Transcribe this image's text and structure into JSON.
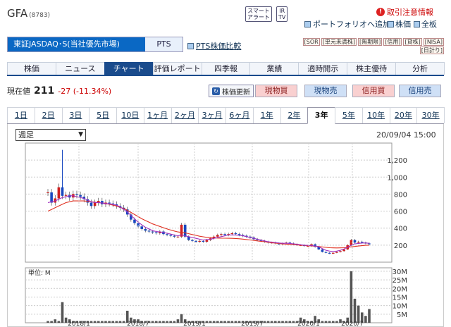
{
  "header": {
    "company": "GFA",
    "code": "(8783)",
    "btn_smart_line1": "スマート",
    "btn_smart_line2": "アラート",
    "btn_ir_line1": "IR",
    "btn_ir_line2": "TV",
    "alert_label": "取引注意情報",
    "portfolio_label": "ポートフォリオへ追加",
    "link_stock": "株価",
    "link_board": "全板"
  },
  "market": {
    "selected": "東証JASDAQ･S(当社優先市場)",
    "pts": "PTS",
    "pts_compare": "PTS株価比較"
  },
  "tags": {
    "line1": [
      "[SOR",
      "[単元未満株]",
      "[無期限]",
      "[信用]",
      "[貸株]",
      "[NISA]"
    ],
    "line2": "[日計り]"
  },
  "nav": [
    "株価",
    "ニュース",
    "チャート",
    "評価レポート",
    "四季報",
    "業績",
    "適時開示",
    "株主優待",
    "分析"
  ],
  "nav_active": 2,
  "price": {
    "label": "現在値",
    "value": "211",
    "change": "-27 (-11.34%)",
    "refresh": "株価更新",
    "buy_spot": "現物買",
    "sell_spot": "現物売",
    "buy_margin": "信用買",
    "sell_margin": "信用売"
  },
  "ranges": [
    "1日",
    "2日",
    "3日",
    "5日",
    "10日",
    "1ヶ月",
    "2ヶ月",
    "3ヶ月",
    "6ヶ月",
    "1年",
    "2年",
    "3年",
    "5年",
    "10年",
    "20年",
    "30年"
  ],
  "range_active": 11,
  "period_select": "週足",
  "datestamp": "20/09/04 15:00",
  "colors": {
    "buy": "#f9d0d0",
    "sell": "#cfe0f6",
    "nav_active": "#1a4b8c",
    "ma_short": "#a030c0",
    "ma_long": "#e03020",
    "up": "#d02020",
    "down": "#1848c0",
    "volume": "#555555"
  },
  "chart_data": {
    "type": "candlestick",
    "price_ylim": [
      0,
      1400
    ],
    "price_ticks": [
      "1,200",
      "1,000",
      "800",
      "600",
      "400",
      "200"
    ],
    "price_tick_values": [
      1200,
      1000,
      800,
      600,
      400,
      200
    ],
    "volume_label": "単位: M",
    "volume_ticks": [
      "30M",
      "25M",
      "20M",
      "15M",
      "10M",
      "5M"
    ],
    "volume_tick_values": [
      30,
      25,
      20,
      15,
      10,
      5
    ],
    "volume_ylim": [
      0,
      32
    ],
    "x_labels": [
      "2018/1",
      "2018/7",
      "2019/1",
      "2019/7",
      "2020/1",
      "2020/7"
    ],
    "close_weekly": [
      820,
      700,
      750,
      880,
      780,
      790,
      760,
      800,
      790,
      770,
      740,
      700,
      660,
      700,
      720,
      680,
      700,
      690,
      680,
      660,
      640,
      620,
      560,
      500,
      460,
      420,
      390,
      370,
      360,
      350,
      340,
      360,
      330,
      320,
      310,
      300,
      300,
      440,
      300,
      260,
      250,
      240,
      250,
      240,
      260,
      280,
      300,
      320,
      330,
      320,
      330,
      340,
      330,
      320,
      310,
      300,
      290,
      270,
      260,
      250,
      240,
      230,
      230,
      220,
      210,
      220,
      230,
      220,
      210,
      200,
      200,
      190,
      190,
      210,
      180,
      150,
      120,
      110,
      100,
      110,
      120,
      130,
      150,
      200,
      260,
      230,
      240,
      230,
      220,
      211
    ],
    "ma_short": [
      700,
      710,
      720,
      740,
      760,
      770,
      780,
      780,
      770,
      760,
      750,
      730,
      710,
      700,
      700,
      695,
      690,
      685,
      680,
      670,
      650,
      620,
      590,
      550,
      510,
      470,
      440,
      410,
      390,
      370,
      360,
      355,
      350,
      340,
      330,
      320,
      310,
      320,
      310,
      300,
      290,
      280,
      270,
      260,
      265,
      270,
      280,
      290,
      300,
      310,
      320,
      320,
      320,
      315,
      310,
      300,
      290,
      280,
      270,
      260,
      250,
      240,
      235,
      230,
      225,
      222,
      222,
      220,
      215,
      210,
      205,
      200,
      198,
      195,
      190,
      180,
      160,
      140,
      130,
      125,
      130,
      140,
      155,
      175,
      200,
      215,
      220,
      225,
      225,
      222
    ],
    "ma_long": [
      600,
      620,
      640,
      660,
      680,
      700,
      710,
      720,
      720,
      720,
      720,
      715,
      710,
      705,
      700,
      695,
      690,
      680,
      670,
      660,
      645,
      630,
      610,
      585,
      560,
      535,
      510,
      490,
      470,
      450,
      435,
      420,
      405,
      390,
      378,
      366,
      355,
      350,
      345,
      335,
      325,
      315,
      305,
      298,
      292,
      288,
      285,
      283,
      282,
      282,
      281,
      280,
      278,
      275,
      271,
      266,
      261,
      256,
      250,
      245,
      240,
      234,
      229,
      224,
      219,
      215,
      212,
      209,
      206,
      203,
      200,
      197,
      194,
      191,
      188,
      184,
      179,
      174,
      170,
      168,
      167,
      168,
      170,
      174,
      180,
      185,
      190,
      194,
      198,
      200
    ],
    "volume": [
      1,
      1,
      2,
      1,
      12,
      3,
      2,
      1,
      1,
      1,
      1,
      1,
      1,
      1,
      1,
      1,
      1,
      1,
      1,
      1,
      1,
      1,
      7,
      3,
      2,
      2,
      1,
      1,
      1,
      1,
      1,
      1,
      1,
      1,
      1,
      1,
      2,
      5,
      2,
      1,
      1,
      1,
      1,
      1,
      1,
      1,
      1,
      1,
      1,
      1,
      1,
      1,
      1,
      1,
      1,
      1,
      1,
      1,
      1,
      1,
      1,
      1,
      1,
      1,
      1,
      1,
      1,
      1,
      1,
      1,
      3,
      2,
      1,
      1,
      4,
      2,
      1,
      1,
      1,
      1,
      1,
      2,
      1,
      3,
      30,
      14,
      10,
      6,
      4,
      8
    ]
  }
}
